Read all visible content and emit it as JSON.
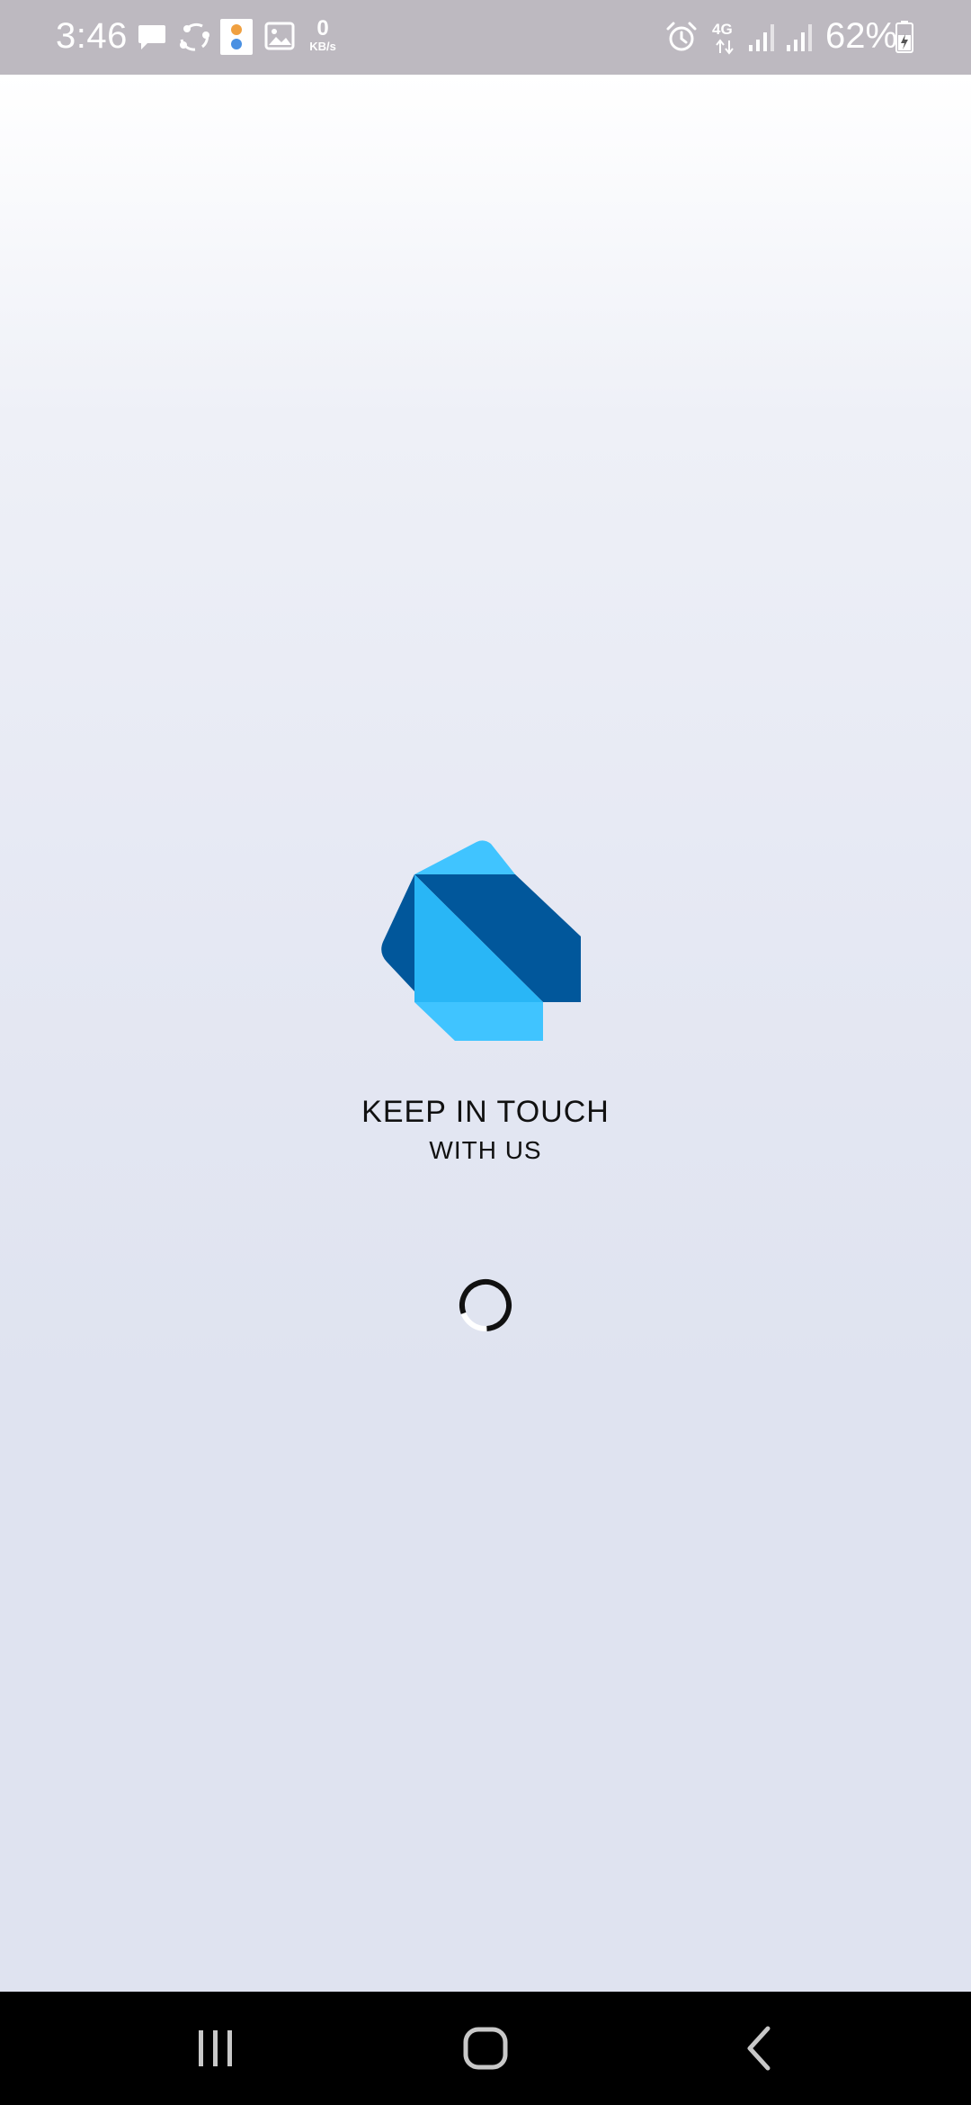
{
  "status_bar": {
    "time": "3:46",
    "net_speed_value": "0",
    "net_speed_unit": "KB/s",
    "network_type": "4G",
    "battery_percent": "62%",
    "icons": [
      "message-icon",
      "share-icon",
      "app-notification-icon",
      "gallery-icon",
      "alarm-icon",
      "signal-icon",
      "signal-icon",
      "battery-icon"
    ]
  },
  "splash": {
    "logo": "dart-logo",
    "headline": "KEEP IN TOUCH",
    "subline": "WITH US",
    "loading": "loading-spinner-icon"
  },
  "nav_bar": {
    "buttons": [
      "recent-apps-icon",
      "home-icon",
      "back-icon"
    ]
  },
  "colors": {
    "status_bar_bg": "#bdb9c0",
    "background": "#dfe3f0",
    "logo_dark": "#01579b",
    "logo_mid": "#29b6f6",
    "logo_light": "#40c4ff",
    "nav_bar_bg": "#000000"
  }
}
